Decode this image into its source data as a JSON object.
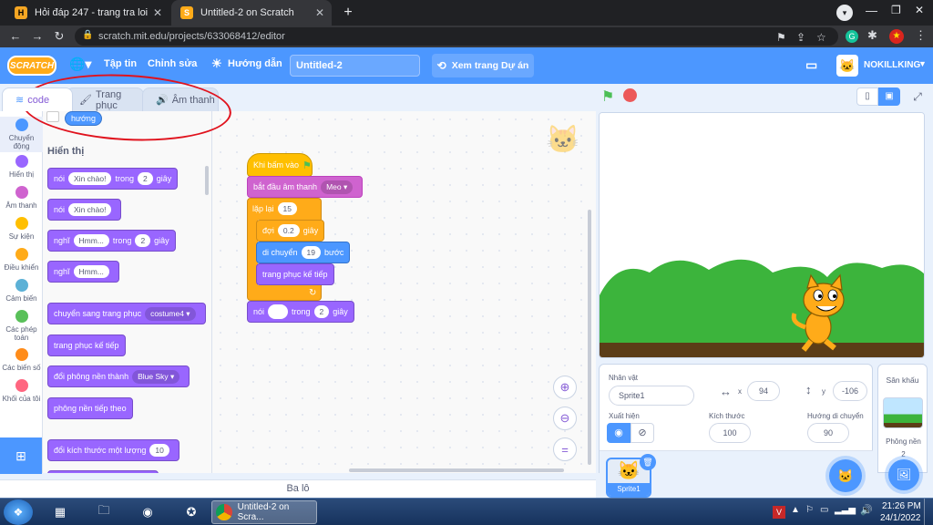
{
  "browser": {
    "tabs": [
      {
        "label": "Hỏi đáp 247 - trang tra loi",
        "favicon": "H"
      },
      {
        "label": "Untitled-2 on Scratch",
        "favicon": "S"
      }
    ],
    "url": "scratch.mit.edu/projects/633068412/editor"
  },
  "menubar": {
    "logo": "SCRATCH",
    "file": "Tập tin",
    "edit": "Chỉnh sửa",
    "tutorials": "Hướng dẫn",
    "project_title": "Untitled-2",
    "see_project": "Xem trang Dự án",
    "username": "NOKILLKING"
  },
  "editor_tabs": {
    "code": "code",
    "costumes": "Trang phục",
    "sounds": "Âm thanh"
  },
  "categories": [
    {
      "label": "Chuyển động",
      "color": "#4c97ff"
    },
    {
      "label": "Hiển thị",
      "color": "#9966ff"
    },
    {
      "label": "Âm thanh",
      "color": "#cf63cf"
    },
    {
      "label": "Sự kiện",
      "color": "#ffbf00"
    },
    {
      "label": "Điều khiển",
      "color": "#ffab19"
    },
    {
      "label": "Cảm biến",
      "color": "#5cb1d6"
    },
    {
      "label": "Các phép toán",
      "color": "#59c059"
    },
    {
      "label": "Các biến số",
      "color": "#ff8c1a"
    },
    {
      "label": "Khối của tôi",
      "color": "#ff6680"
    }
  ],
  "palette": {
    "top_reporter": "hướng",
    "section_title": "Hiển thị",
    "say_for": {
      "say": "nói",
      "msg": "Xin chào!",
      "in": "trong",
      "secs": "2",
      "unit": "giây"
    },
    "say": {
      "say": "nói",
      "msg": "Xin chào!"
    },
    "think_for": {
      "think": "nghĩ",
      "msg": "Hmm...",
      "in": "trong",
      "secs": "2",
      "unit": "giây"
    },
    "think": {
      "think": "nghĩ",
      "msg": "Hmm..."
    },
    "switch_costume": {
      "label": "chuyển sang trang phục",
      "value": "costume4"
    },
    "next_costume": "trang phục kế tiếp",
    "switch_backdrop": {
      "label": "đổi phông nền thành",
      "value": "Blue Sky"
    },
    "next_backdrop": "phông nền tiếp theo",
    "change_size": {
      "label": "đổi kích thước một lượng",
      "value": "10"
    }
  },
  "script": {
    "hat": "Khi bấm vào",
    "start_sound": {
      "label": "bắt đầu âm thanh",
      "value": "Meo"
    },
    "repeat": {
      "label": "lặp lại",
      "value": "15"
    },
    "wait": {
      "label": "đợi",
      "value": "0.2",
      "unit": "giây"
    },
    "move": {
      "label": "di chuyển",
      "value": "19",
      "unit": "bước"
    },
    "next_costume": "trang phục kế tiếp",
    "say_for": {
      "say": "nói",
      "in": "trong",
      "secs": "2",
      "unit": "giây"
    }
  },
  "sprite_info": {
    "sprite_label": "Nhân vật",
    "sprite_name": "Sprite1",
    "x_label": "x",
    "x": "94",
    "y_label": "y",
    "y": "-106",
    "show_label": "Xuất hiện",
    "size_label": "Kích thước",
    "size": "100",
    "direction_label": "Hướng di chuyển",
    "direction": "90",
    "thumb_label": "Sprite1"
  },
  "stage_pane": {
    "title": "Sân khấu",
    "backdrops_label": "Phông nền",
    "backdrops_count": "2"
  },
  "backpack": "Ba lô",
  "taskbar": {
    "time": "21:26 PM",
    "date": "24/1/2022",
    "scratch_task": "Untitled-2 on Scra..."
  }
}
